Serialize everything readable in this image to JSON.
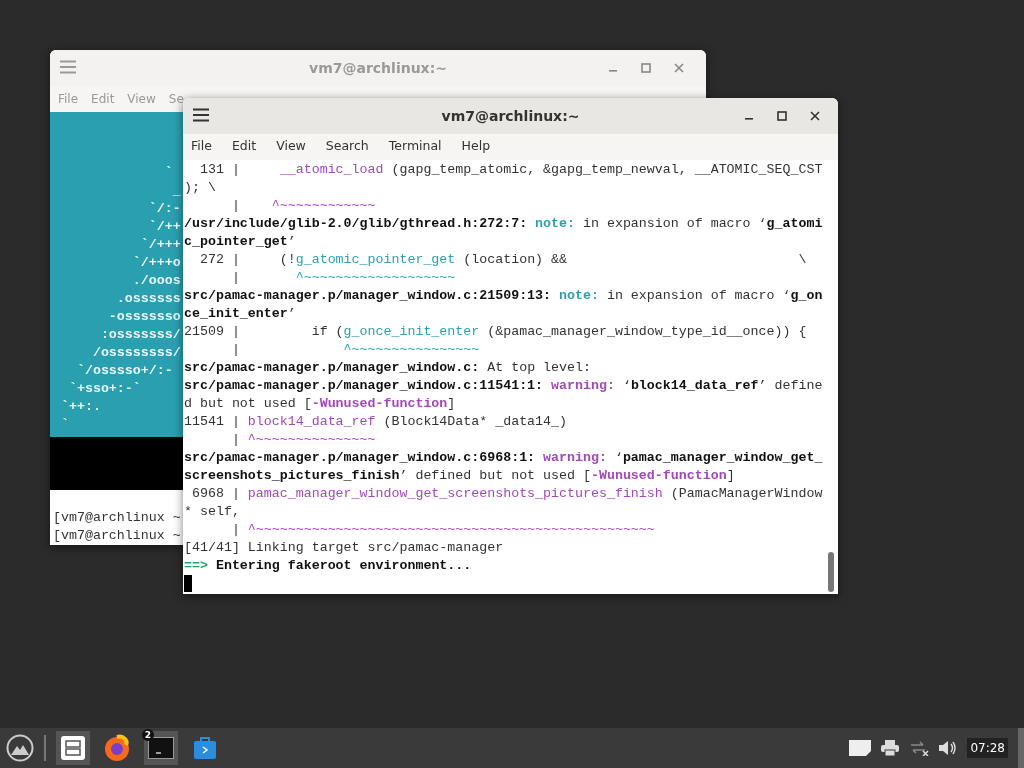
{
  "back_window": {
    "title": "vm7@archlinux:~",
    "menu": [
      "File",
      "Edit",
      "View",
      "Se"
    ],
    "logo_lines": [
      "              `",
      "               _",
      "            `/:-",
      "            `/++",
      "           `/+++",
      "          `/+++o",
      "          ./ooos",
      "        .ossssss",
      "       -osssssso",
      "      :osssssss/",
      "     /ossssssss/",
      "   `/osssso+/:-",
      "  `+sso+:-`",
      " `++:.",
      " `"
    ],
    "prompts": [
      "[vm7@archlinux ~",
      "[vm7@archlinux ~"
    ]
  },
  "front_window": {
    "title": "vm7@archlinux:~",
    "menu": [
      "File",
      "Edit",
      "View",
      "Search",
      "Terminal",
      "Help"
    ],
    "lines": [
      [
        {
          "kind": "plain",
          "text": "  131 |     "
        },
        {
          "kind": "purple",
          "text": "__atomic_load"
        },
        {
          "kind": "plain",
          "text": " (gapg_temp_atomic, &gapg_temp_newval, __ATOMIC_SEQ_CST"
        }
      ],
      [
        {
          "kind": "plain",
          "text": "); \\"
        }
      ],
      [
        {
          "kind": "plain",
          "text": "      |    "
        },
        {
          "kind": "purple",
          "text": "^~~~~~~~~~~~~"
        }
      ],
      [
        {
          "kind": "bold",
          "text": "/usr/include/glib-2.0/glib/gthread.h:272:7: "
        },
        {
          "kind": "cyan_bold",
          "text": "note:"
        },
        {
          "kind": "plain",
          "text": " in expansion of macro ‘"
        },
        {
          "kind": "bold",
          "text": "g_atomi"
        }
      ],
      [
        {
          "kind": "bold",
          "text": "c_pointer_get"
        },
        {
          "kind": "plain",
          "text": "’"
        }
      ],
      [
        {
          "kind": "plain",
          "text": "  272 |     (!"
        },
        {
          "kind": "cyan",
          "text": "g_atomic_pointer_get"
        },
        {
          "kind": "plain",
          "text": " (location) &&                             \\"
        }
      ],
      [
        {
          "kind": "plain",
          "text": "      |       "
        },
        {
          "kind": "cyan",
          "text": "^~~~~~~~~~~~~~~~~~~~"
        }
      ],
      [
        {
          "kind": "bold",
          "text": "src/pamac-manager.p/manager_window.c:21509:13: "
        },
        {
          "kind": "cyan_bold",
          "text": "note:"
        },
        {
          "kind": "plain",
          "text": " in expansion of macro ‘"
        },
        {
          "kind": "bold",
          "text": "g_on"
        }
      ],
      [
        {
          "kind": "bold",
          "text": "ce_init_enter"
        },
        {
          "kind": "plain",
          "text": "’"
        }
      ],
      [
        {
          "kind": "plain",
          "text": "21509 |         if ("
        },
        {
          "kind": "cyan",
          "text": "g_once_init_enter"
        },
        {
          "kind": "plain",
          "text": " (&pamac_manager_window_type_id__once)) {"
        }
      ],
      [
        {
          "kind": "plain",
          "text": "      |             "
        },
        {
          "kind": "cyan",
          "text": "^~~~~~~~~~~~~~~~~"
        }
      ],
      [
        {
          "kind": "bold",
          "text": "src/pamac-manager.p/manager_window.c:"
        },
        {
          "kind": "plain",
          "text": " At top level:"
        }
      ],
      [
        {
          "kind": "bold",
          "text": "src/pamac-manager.p/manager_window.c:11541:1: "
        },
        {
          "kind": "purple_bold",
          "text": "warning:"
        },
        {
          "kind": "plain",
          "text": " ‘"
        },
        {
          "kind": "bold",
          "text": "block14_data_ref"
        },
        {
          "kind": "plain",
          "text": "’ define"
        }
      ],
      [
        {
          "kind": "plain",
          "text": "d but not used ["
        },
        {
          "kind": "purple_bold",
          "text": "-Wunused-function"
        },
        {
          "kind": "plain",
          "text": "]"
        }
      ],
      [
        {
          "kind": "plain",
          "text": "11541 | "
        },
        {
          "kind": "purple",
          "text": "block14_data_ref"
        },
        {
          "kind": "plain",
          "text": " (Block14Data* _data14_)"
        }
      ],
      [
        {
          "kind": "plain",
          "text": "      | "
        },
        {
          "kind": "purple",
          "text": "^~~~~~~~~~~~~~~~"
        }
      ],
      [
        {
          "kind": "bold",
          "text": "src/pamac-manager.p/manager_window.c:6968:1: "
        },
        {
          "kind": "purple_bold",
          "text": "warning:"
        },
        {
          "kind": "plain",
          "text": " ‘"
        },
        {
          "kind": "bold",
          "text": "pamac_manager_window_get_"
        }
      ],
      [
        {
          "kind": "bold",
          "text": "screenshots_pictures_finish"
        },
        {
          "kind": "plain",
          "text": "’ defined but not used ["
        },
        {
          "kind": "purple_bold",
          "text": "-Wunused-function"
        },
        {
          "kind": "plain",
          "text": "]"
        }
      ],
      [
        {
          "kind": "plain",
          "text": " 6968 | "
        },
        {
          "kind": "purple",
          "text": "pamac_manager_window_get_screenshots_pictures_finish"
        },
        {
          "kind": "plain",
          "text": " (PamacManagerWindow"
        }
      ],
      [
        {
          "kind": "plain",
          "text": "* self,"
        }
      ],
      [
        {
          "kind": "plain",
          "text": "      | "
        },
        {
          "kind": "purple",
          "text": "^~~~~~~~~~~~~~~~~~~~~~~~~~~~~~~~~~~~~~~~~~~~~~~~~~~"
        }
      ],
      [
        {
          "kind": "plain",
          "text": "[41/41] Linking target src/pamac-manager"
        }
      ],
      [
        {
          "kind": "green_bold",
          "text": "==>"
        },
        {
          "kind": "bold",
          "text": " Entering fakeroot environment..."
        }
      ]
    ]
  },
  "taskbar": {
    "terminal_badge": "2",
    "clock": "07:28"
  }
}
